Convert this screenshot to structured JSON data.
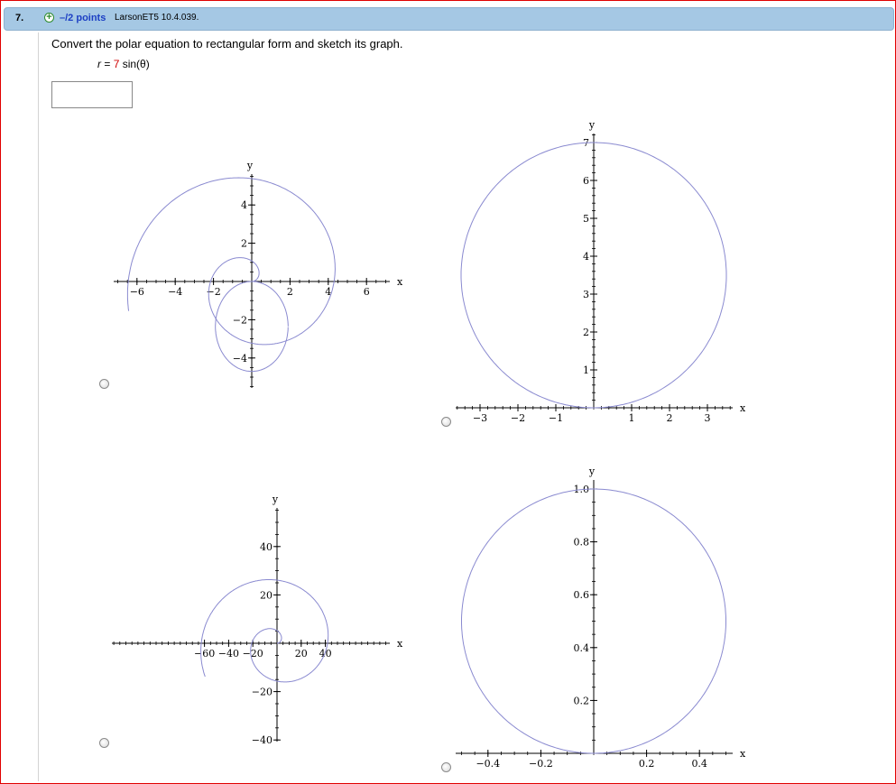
{
  "question": {
    "number": "7.",
    "points": "–/2 points",
    "source": "LarsonET5 10.4.039.",
    "prompt": "Convert the polar equation to rectangular form and sketch its graph.",
    "equation": {
      "lhs": "r",
      "eq": " = ",
      "coef": "7",
      "rest": " sin(θ)"
    },
    "answer_value": ""
  },
  "colors": {
    "curve": "#8a8ad0",
    "accent_red": "#d00000",
    "header": "#a5c8e4"
  },
  "chart_data": [
    {
      "type": "line",
      "description_curve": "spiral r = 7θ style loop graph",
      "xlabel": "x",
      "ylabel": "y",
      "xticks": [
        "−6",
        "−4",
        "−2",
        "2",
        "4",
        "6"
      ],
      "yticks": [
        "−4",
        "−2",
        "2",
        "4"
      ],
      "xlim": [
        -7,
        7
      ],
      "ylim": [
        -5,
        5.5
      ]
    },
    {
      "type": "line",
      "curve": "circle x^2 + (y-3.5)^2 = 3.5^2",
      "xlabel": "x",
      "ylabel": "y",
      "xticks": [
        "−3",
        "−2",
        "−1",
        "1",
        "2",
        "3"
      ],
      "yticks": [
        "1",
        "2",
        "3",
        "4",
        "5",
        "6",
        "7"
      ],
      "xlim": [
        -3.6,
        3.6
      ],
      "ylim": [
        0,
        7
      ]
    },
    {
      "type": "line",
      "curve": "spiral r = 7θ",
      "xlabel": "x",
      "ylabel": "y",
      "xticks": [
        "−60",
        "−40",
        "−20",
        "20",
        "40"
      ],
      "yticks": [
        "−40",
        "−20",
        "20",
        "40"
      ],
      "xlim": [
        -65,
        45
      ],
      "ylim": [
        -40,
        55
      ]
    },
    {
      "type": "line",
      "curve": "circle x^2 + (y-0.5)^2 = 0.5^2",
      "xlabel": "x",
      "ylabel": "y",
      "xticks": [
        "−0.4",
        "−0.2",
        "0.2",
        "0.4"
      ],
      "yticks": [
        "0.2",
        "0.4",
        "0.6",
        "0.8",
        "1.0"
      ],
      "xlim": [
        -0.52,
        0.52
      ],
      "ylim": [
        0,
        1
      ]
    }
  ]
}
